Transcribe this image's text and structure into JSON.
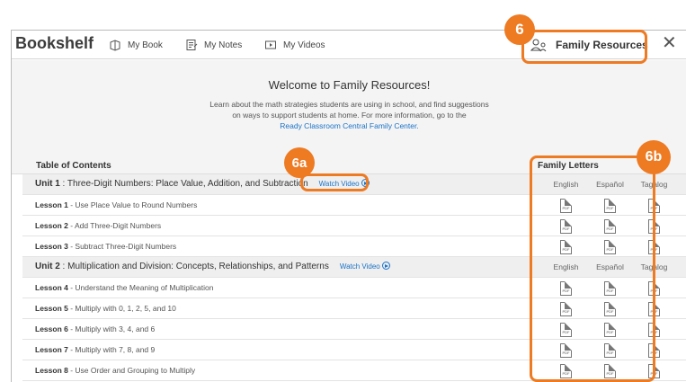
{
  "header": {
    "brand": "Bookshelf",
    "nav": [
      {
        "label": "My Book",
        "icon": "book-icon"
      },
      {
        "label": "My Notes",
        "icon": "notes-icon"
      },
      {
        "label": "My Videos",
        "icon": "video-icon"
      }
    ],
    "family_resources": "Family Resources",
    "close": "✕"
  },
  "welcome": {
    "title": "Welcome to Family Resources!",
    "line1": "Learn about the math strategies students are using in school, and find suggestions",
    "line2": "on ways to support students at home. For more information, go to the",
    "link": "Ready Classroom Central Family Center."
  },
  "toc_title": "Table of Contents",
  "family_letters_title": "Family Letters",
  "languages": [
    "English",
    "Español",
    "Tagalog"
  ],
  "pdf_label": "PDF",
  "watch_video": "Watch Video",
  "rows": [
    {
      "type": "unit",
      "num": "Unit 1",
      "title": " : Three-Digit Numbers: Place Value, Addition, and Subtraction"
    },
    {
      "type": "lesson",
      "num": "Lesson 1",
      "title": " - Use Place Value to Round Numbers"
    },
    {
      "type": "lesson",
      "num": "Lesson 2",
      "title": " - Add Three-Digit Numbers"
    },
    {
      "type": "lesson",
      "num": "Lesson 3",
      "title": " - Subtract Three-Digit Numbers"
    },
    {
      "type": "unit",
      "num": "Unit 2",
      "title": " : Multiplication and Division: Concepts, Relationships, and Patterns"
    },
    {
      "type": "lesson",
      "num": "Lesson 4",
      "title": " - Understand the Meaning of Multiplication"
    },
    {
      "type": "lesson",
      "num": "Lesson 5",
      "title": " - Multiply with 0, 1, 2, 5, and 10"
    },
    {
      "type": "lesson",
      "num": "Lesson 6",
      "title": " - Multiply with 3, 4, and 6"
    },
    {
      "type": "lesson",
      "num": "Lesson 7",
      "title": " - Multiply with 7, 8, and 9"
    },
    {
      "type": "lesson",
      "num": "Lesson 8",
      "title": " - Use Order and Grouping to Multiply"
    }
  ],
  "callouts": {
    "main": "6",
    "a": "6a",
    "b": "6b"
  },
  "colors": {
    "accent": "#ee7a22",
    "link": "#1a73c9"
  }
}
